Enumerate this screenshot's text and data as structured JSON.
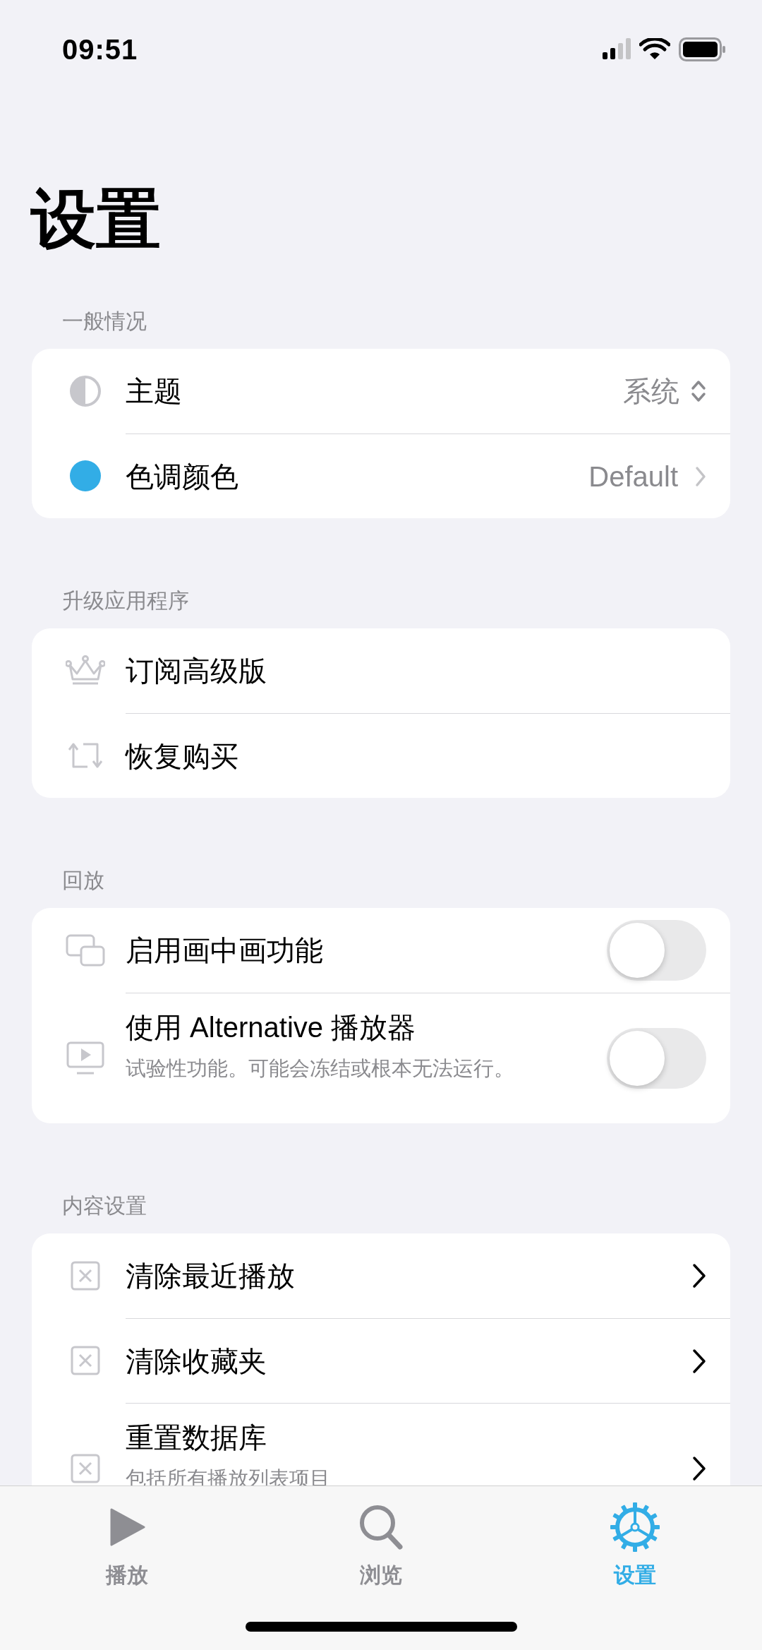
{
  "status_bar": {
    "time": "09:51"
  },
  "title": "设置",
  "sections": [
    {
      "header": "一般情况",
      "rows": [
        {
          "kind": "picker",
          "label": "主题",
          "value": "系统"
        },
        {
          "kind": "link",
          "label": "色调颜色",
          "value": "Default"
        }
      ]
    },
    {
      "header": "升级应用程序",
      "rows": [
        {
          "kind": "plain",
          "label": "订阅高级版"
        },
        {
          "kind": "plain",
          "label": "恢复购买"
        }
      ]
    },
    {
      "header": "回放",
      "rows": [
        {
          "kind": "toggle",
          "label": "启用画中画功能",
          "on": false
        },
        {
          "kind": "toggle",
          "label": "使用 Alternative 播放器",
          "subtitle": "试验性功能。可能会冻结或根本无法运行。",
          "on": false
        }
      ]
    },
    {
      "header": "内容设置",
      "rows": [
        {
          "kind": "nav",
          "label": "清除最近播放"
        },
        {
          "kind": "nav",
          "label": "清除收藏夹"
        },
        {
          "kind": "nav",
          "label": "重置数据库",
          "subtitle": "包括所有播放列表项目"
        }
      ]
    }
  ],
  "tab_bar": [
    {
      "label": "播放",
      "selected": false
    },
    {
      "label": "浏览",
      "selected": false
    },
    {
      "label": "设置",
      "selected": true
    }
  ]
}
